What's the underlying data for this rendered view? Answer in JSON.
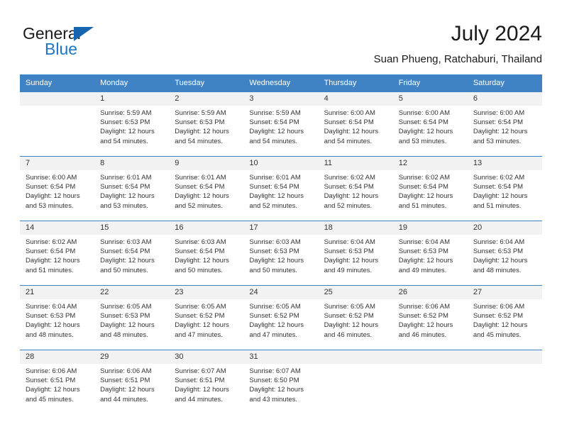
{
  "logo": {
    "primary_text": "General",
    "secondary_text": "Blue",
    "triangle_icon": "blue-triangle-icon",
    "primary_color": "#1a1a1a",
    "secondary_color": "#1e76c4"
  },
  "header": {
    "title": "July 2024",
    "subtitle": "Suan Phueng, Ratchaburi, Thailand"
  },
  "theme": {
    "header_bg": "#3f83c4",
    "daynum_bg": "#f2f2f2",
    "text_color": "#333333",
    "grid_line": "#3f83c4"
  },
  "weekday_headers": [
    "Sunday",
    "Monday",
    "Tuesday",
    "Wednesday",
    "Thursday",
    "Friday",
    "Saturday"
  ],
  "weeks": [
    [
      {
        "day": "",
        "lines": []
      },
      {
        "day": "1",
        "lines": [
          "Sunrise: 5:59 AM",
          "Sunset: 6:53 PM",
          "Daylight: 12 hours",
          "and 54 minutes."
        ]
      },
      {
        "day": "2",
        "lines": [
          "Sunrise: 5:59 AM",
          "Sunset: 6:53 PM",
          "Daylight: 12 hours",
          "and 54 minutes."
        ]
      },
      {
        "day": "3",
        "lines": [
          "Sunrise: 5:59 AM",
          "Sunset: 6:54 PM",
          "Daylight: 12 hours",
          "and 54 minutes."
        ]
      },
      {
        "day": "4",
        "lines": [
          "Sunrise: 6:00 AM",
          "Sunset: 6:54 PM",
          "Daylight: 12 hours",
          "and 54 minutes."
        ]
      },
      {
        "day": "5",
        "lines": [
          "Sunrise: 6:00 AM",
          "Sunset: 6:54 PM",
          "Daylight: 12 hours",
          "and 53 minutes."
        ]
      },
      {
        "day": "6",
        "lines": [
          "Sunrise: 6:00 AM",
          "Sunset: 6:54 PM",
          "Daylight: 12 hours",
          "and 53 minutes."
        ]
      }
    ],
    [
      {
        "day": "7",
        "lines": [
          "Sunrise: 6:00 AM",
          "Sunset: 6:54 PM",
          "Daylight: 12 hours",
          "and 53 minutes."
        ]
      },
      {
        "day": "8",
        "lines": [
          "Sunrise: 6:01 AM",
          "Sunset: 6:54 PM",
          "Daylight: 12 hours",
          "and 53 minutes."
        ]
      },
      {
        "day": "9",
        "lines": [
          "Sunrise: 6:01 AM",
          "Sunset: 6:54 PM",
          "Daylight: 12 hours",
          "and 52 minutes."
        ]
      },
      {
        "day": "10",
        "lines": [
          "Sunrise: 6:01 AM",
          "Sunset: 6:54 PM",
          "Daylight: 12 hours",
          "and 52 minutes."
        ]
      },
      {
        "day": "11",
        "lines": [
          "Sunrise: 6:02 AM",
          "Sunset: 6:54 PM",
          "Daylight: 12 hours",
          "and 52 minutes."
        ]
      },
      {
        "day": "12",
        "lines": [
          "Sunrise: 6:02 AM",
          "Sunset: 6:54 PM",
          "Daylight: 12 hours",
          "and 51 minutes."
        ]
      },
      {
        "day": "13",
        "lines": [
          "Sunrise: 6:02 AM",
          "Sunset: 6:54 PM",
          "Daylight: 12 hours",
          "and 51 minutes."
        ]
      }
    ],
    [
      {
        "day": "14",
        "lines": [
          "Sunrise: 6:02 AM",
          "Sunset: 6:54 PM",
          "Daylight: 12 hours",
          "and 51 minutes."
        ]
      },
      {
        "day": "15",
        "lines": [
          "Sunrise: 6:03 AM",
          "Sunset: 6:54 PM",
          "Daylight: 12 hours",
          "and 50 minutes."
        ]
      },
      {
        "day": "16",
        "lines": [
          "Sunrise: 6:03 AM",
          "Sunset: 6:54 PM",
          "Daylight: 12 hours",
          "and 50 minutes."
        ]
      },
      {
        "day": "17",
        "lines": [
          "Sunrise: 6:03 AM",
          "Sunset: 6:53 PM",
          "Daylight: 12 hours",
          "and 50 minutes."
        ]
      },
      {
        "day": "18",
        "lines": [
          "Sunrise: 6:04 AM",
          "Sunset: 6:53 PM",
          "Daylight: 12 hours",
          "and 49 minutes."
        ]
      },
      {
        "day": "19",
        "lines": [
          "Sunrise: 6:04 AM",
          "Sunset: 6:53 PM",
          "Daylight: 12 hours",
          "and 49 minutes."
        ]
      },
      {
        "day": "20",
        "lines": [
          "Sunrise: 6:04 AM",
          "Sunset: 6:53 PM",
          "Daylight: 12 hours",
          "and 48 minutes."
        ]
      }
    ],
    [
      {
        "day": "21",
        "lines": [
          "Sunrise: 6:04 AM",
          "Sunset: 6:53 PM",
          "Daylight: 12 hours",
          "and 48 minutes."
        ]
      },
      {
        "day": "22",
        "lines": [
          "Sunrise: 6:05 AM",
          "Sunset: 6:53 PM",
          "Daylight: 12 hours",
          "and 48 minutes."
        ]
      },
      {
        "day": "23",
        "lines": [
          "Sunrise: 6:05 AM",
          "Sunset: 6:52 PM",
          "Daylight: 12 hours",
          "and 47 minutes."
        ]
      },
      {
        "day": "24",
        "lines": [
          "Sunrise: 6:05 AM",
          "Sunset: 6:52 PM",
          "Daylight: 12 hours",
          "and 47 minutes."
        ]
      },
      {
        "day": "25",
        "lines": [
          "Sunrise: 6:05 AM",
          "Sunset: 6:52 PM",
          "Daylight: 12 hours",
          "and 46 minutes."
        ]
      },
      {
        "day": "26",
        "lines": [
          "Sunrise: 6:06 AM",
          "Sunset: 6:52 PM",
          "Daylight: 12 hours",
          "and 46 minutes."
        ]
      },
      {
        "day": "27",
        "lines": [
          "Sunrise: 6:06 AM",
          "Sunset: 6:52 PM",
          "Daylight: 12 hours",
          "and 45 minutes."
        ]
      }
    ],
    [
      {
        "day": "28",
        "lines": [
          "Sunrise: 6:06 AM",
          "Sunset: 6:51 PM",
          "Daylight: 12 hours",
          "and 45 minutes."
        ]
      },
      {
        "day": "29",
        "lines": [
          "Sunrise: 6:06 AM",
          "Sunset: 6:51 PM",
          "Daylight: 12 hours",
          "and 44 minutes."
        ]
      },
      {
        "day": "30",
        "lines": [
          "Sunrise: 6:07 AM",
          "Sunset: 6:51 PM",
          "Daylight: 12 hours",
          "and 44 minutes."
        ]
      },
      {
        "day": "31",
        "lines": [
          "Sunrise: 6:07 AM",
          "Sunset: 6:50 PM",
          "Daylight: 12 hours",
          "and 43 minutes."
        ]
      },
      {
        "day": "",
        "lines": []
      },
      {
        "day": "",
        "lines": []
      },
      {
        "day": "",
        "lines": []
      }
    ]
  ]
}
